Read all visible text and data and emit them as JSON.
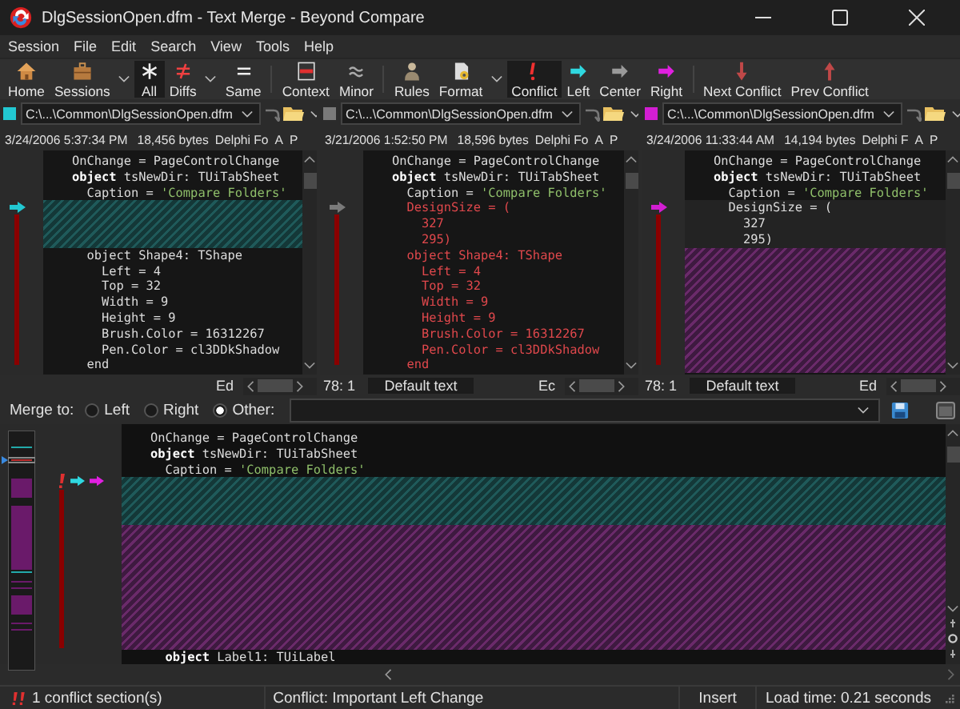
{
  "window": {
    "title": "DlgSessionOpen.dfm - Text Merge - Beyond Compare"
  },
  "menu": [
    "Session",
    "File",
    "Edit",
    "Search",
    "View",
    "Tools",
    "Help"
  ],
  "toolbar": [
    {
      "label": "Home",
      "selected": false,
      "dropdown": false,
      "separator": false
    },
    {
      "label": "Sessions",
      "selected": false,
      "dropdown": true,
      "separator": false
    },
    {
      "label": "All",
      "selected": true,
      "dropdown": false,
      "separator": false
    },
    {
      "label": "Diffs",
      "selected": false,
      "dropdown": true,
      "separator": false
    },
    {
      "label": "Same",
      "selected": false,
      "dropdown": false,
      "separator": false
    },
    {
      "label": "Context",
      "selected": false,
      "dropdown": false,
      "separator": true
    },
    {
      "label": "Minor",
      "selected": false,
      "dropdown": false,
      "separator": false
    },
    {
      "label": "Rules",
      "selected": false,
      "dropdown": false,
      "separator": true
    },
    {
      "label": "Format",
      "selected": false,
      "dropdown": true,
      "separator": false
    },
    {
      "label": "Conflict",
      "selected": true,
      "dropdown": false,
      "separator": false
    },
    {
      "label": "Left",
      "selected": false,
      "dropdown": false,
      "separator": false
    },
    {
      "label": "Center",
      "selected": false,
      "dropdown": false,
      "separator": false
    },
    {
      "label": "Right",
      "selected": false,
      "dropdown": false,
      "separator": false
    },
    {
      "label": "Next Conflict",
      "selected": false,
      "dropdown": false,
      "separator": true
    },
    {
      "label": "Prev Conflict",
      "selected": false,
      "dropdown": false,
      "separator": false
    }
  ],
  "panes": [
    {
      "color": "#22c8d2",
      "path": "C:\\...\\Common\\DlgSessionOpen.dfm",
      "date": "3/24/2006 5:37:34 PM",
      "size": "18,456 bytes",
      "format": "Delphi Fo",
      "flags": [
        "A",
        "P"
      ],
      "lines": [
        {
          "kind": "text",
          "text": "OnChange = PageControlChange"
        },
        {
          "kind": "text",
          "text": "**object** tsNewDir: TUiTabSheet"
        },
        {
          "kind": "text",
          "text": "  Caption = ",
          "string": "'Compare Folders'"
        },
        {
          "kind": "gap-cyan"
        },
        {
          "kind": "gap-cyan"
        },
        {
          "kind": "gap-cyan"
        },
        {
          "kind": "text",
          "text": "  object Shape4: TShape"
        },
        {
          "kind": "text",
          "text": "    Left = 4"
        },
        {
          "kind": "text",
          "text": "    Top = 32"
        },
        {
          "kind": "text",
          "text": "    Width = 9"
        },
        {
          "kind": "text",
          "text": "    Height = 9"
        },
        {
          "kind": "text",
          "text": "    Brush.Color = 16312267"
        },
        {
          "kind": "text",
          "text": "    Pen.Color = cl3DDkShadow"
        },
        {
          "kind": "text",
          "text": "  end"
        }
      ],
      "status": {
        "mode": "Ed"
      }
    },
    {
      "color": "#7a7a7a",
      "path": "C:\\...\\Common\\DlgSessionOpen.dfm",
      "date": "3/21/2006 1:52:50 PM",
      "size": "18,596 bytes",
      "format": "Delphi Fo",
      "flags": [
        "A",
        "P"
      ],
      "lines": [
        {
          "kind": "text",
          "text": "OnChange = PageControlChange"
        },
        {
          "kind": "text",
          "text": "**object** tsNewDir: TUiTabSheet"
        },
        {
          "kind": "text",
          "text": "  Caption = ",
          "string": "'Compare Folders'"
        },
        {
          "kind": "diff",
          "text": "  DesignSize = ("
        },
        {
          "kind": "diff",
          "text": "    327"
        },
        {
          "kind": "diff",
          "text": "    295)"
        },
        {
          "kind": "diff",
          "text": "  object Shape4: TShape"
        },
        {
          "kind": "diff",
          "text": "    Left = 4"
        },
        {
          "kind": "diff",
          "text": "    Top = 32"
        },
        {
          "kind": "diff",
          "text": "    Width = 9"
        },
        {
          "kind": "diff",
          "text": "    Height = 9"
        },
        {
          "kind": "diff",
          "text": "    Brush.Color = 16312267"
        },
        {
          "kind": "diff",
          "text": "    Pen.Color = cl3DDkShadow"
        },
        {
          "kind": "diff",
          "text": "  end"
        }
      ],
      "status": {
        "position": "78: 1",
        "encoding": "Default text",
        "mode": "Ec"
      }
    },
    {
      "color": "#d21ed2",
      "path": "C:\\...\\Common\\DlgSessionOpen.dfm",
      "date": "3/24/2006 11:33:44 AM",
      "size": "14,194 bytes",
      "format": "Delphi F",
      "flags": [
        "A",
        "P"
      ],
      "lines": [
        {
          "kind": "text",
          "text": "OnChange = PageControlChange"
        },
        {
          "kind": "text",
          "text": "**object** tsNewDir: TUiTabSheet"
        },
        {
          "kind": "text",
          "text": "  Caption = ",
          "string": "'Compare Folders'"
        },
        {
          "kind": "block",
          "text": "  DesignSize = ("
        },
        {
          "kind": "block",
          "text": "    327"
        },
        {
          "kind": "block",
          "text": "    295)"
        },
        {
          "kind": "gap-magenta"
        },
        {
          "kind": "gap-magenta"
        },
        {
          "kind": "gap-magenta"
        },
        {
          "kind": "gap-magenta"
        },
        {
          "kind": "gap-magenta"
        },
        {
          "kind": "gap-magenta"
        },
        {
          "kind": "gap-magenta"
        },
        {
          "kind": "gap-magenta"
        }
      ],
      "status": {
        "position": "78: 1",
        "encoding": "Default text",
        "mode": "Ed"
      }
    }
  ],
  "merge": {
    "label": "Merge to:",
    "targets": [
      {
        "label": "Left",
        "selected": false
      },
      {
        "label": "Right",
        "selected": false
      },
      {
        "label": "Other:",
        "selected": true
      }
    ],
    "lines": [
      {
        "kind": "text",
        "text": "OnChange = PageControlChange"
      },
      {
        "kind": "text",
        "text": "**object** tsNewDir: TUiTabSheet"
      },
      {
        "kind": "text",
        "text": "  Caption = ",
        "string": "'Compare Folders'"
      },
      {
        "kind": "gap-cyan"
      },
      {
        "kind": "gap-cyan"
      },
      {
        "kind": "gap-cyan"
      },
      {
        "kind": "gap-magenta"
      },
      {
        "kind": "gap-magenta"
      },
      {
        "kind": "gap-magenta"
      },
      {
        "kind": "gap-magenta"
      },
      {
        "kind": "gap-magenta"
      },
      {
        "kind": "gap-magenta"
      },
      {
        "kind": "gap-magenta"
      },
      {
        "kind": "gap-magenta"
      },
      {
        "kind": "text",
        "text": "  **object** Label1: TUiLabel"
      }
    ]
  },
  "status_bar": {
    "conflicts": "1 conflict section(s)",
    "message": "Conflict: Important Left Change",
    "mode": "Insert",
    "load_time": "Load time: 0.21 seconds"
  }
}
